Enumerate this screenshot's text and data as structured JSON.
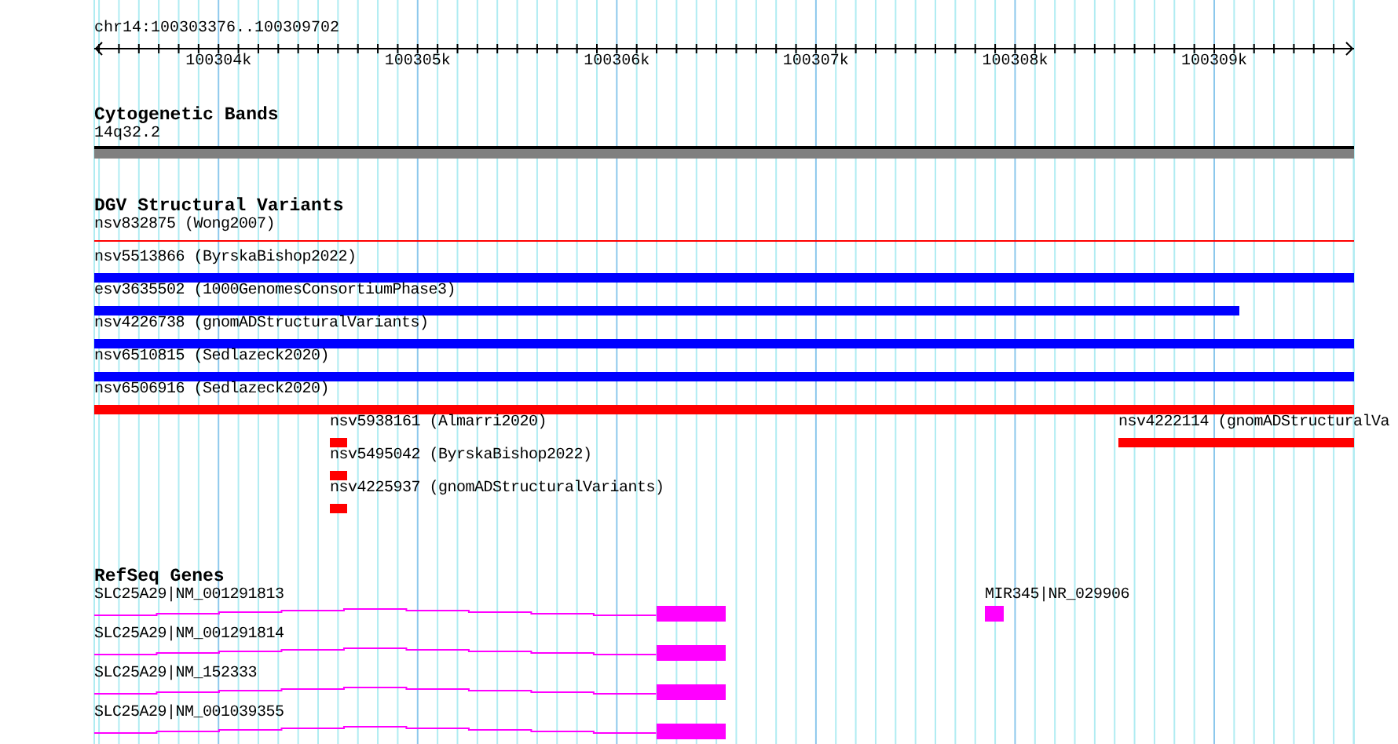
{
  "ruler": {
    "region": "chr14:100303376..100309702",
    "ticks": [
      "100304k",
      "100305k",
      "100306k",
      "100307k",
      "100308k",
      "100309k"
    ]
  },
  "tracks": [
    {
      "kind": "bands",
      "title": "Cytogenetic Bands",
      "rows": [
        {
          "features": [
            {
              "kind": "band",
              "label": "14q32.2",
              "color": "#808080"
            }
          ]
        }
      ]
    },
    {
      "kind": "variants",
      "title": "DGV Structural Variants",
      "rows": [
        {
          "features": [
            {
              "kind": "line",
              "label": "nsv832875 (Wong2007)",
              "color": "#ff0000"
            }
          ]
        },
        {
          "features": [
            {
              "kind": "bar",
              "label": "nsv5513866 (ByrskaBishop2022)",
              "color": "#0000ff"
            }
          ]
        },
        {
          "features": [
            {
              "kind": "bar",
              "label": "esv3635502 (1000GenomesConsortiumPhase3)",
              "color": "#0000ff"
            }
          ]
        },
        {
          "features": [
            {
              "kind": "bar",
              "label": "nsv4226738 (gnomADStructuralVariants)",
              "color": "#0000ff"
            }
          ]
        },
        {
          "features": [
            {
              "kind": "bar",
              "label": "nsv6510815 (Sedlazeck2020)",
              "color": "#0000ff"
            }
          ]
        },
        {
          "features": [
            {
              "kind": "bar",
              "label": "nsv6506916 (Sedlazeck2020)",
              "color": "#ff0000"
            }
          ]
        },
        {
          "features": [
            {
              "kind": "bar",
              "label": "nsv5938161 (Almarri2020)",
              "color": "#ff0000"
            },
            {
              "kind": "bar",
              "label": "nsv4222114 (gnomADStructuralVa",
              "color": "#ff0000"
            }
          ]
        },
        {
          "features": [
            {
              "kind": "bar",
              "label": "nsv5495042 (ByrskaBishop2022)",
              "color": "#ff0000"
            }
          ]
        },
        {
          "features": [
            {
              "kind": "bar",
              "label": "nsv4225937 (gnomADStructuralVariants)",
              "color": "#ff0000"
            }
          ]
        }
      ]
    },
    {
      "kind": "genes",
      "title": "RefSeq Genes",
      "rows": [
        {
          "features": [
            {
              "kind": "transcript",
              "label": "SLC25A29|NM_001291813",
              "color": "#ff00ff"
            },
            {
              "kind": "exon",
              "label": "MIR345|NR_029906",
              "color": "#ff00ff"
            }
          ]
        },
        {
          "features": [
            {
              "kind": "transcript",
              "label": "SLC25A29|NM_001291814",
              "color": "#ff00ff"
            }
          ]
        },
        {
          "features": [
            {
              "kind": "transcript",
              "label": "SLC25A29|NM_152333",
              "color": "#ff00ff"
            }
          ]
        },
        {
          "features": [
            {
              "kind": "transcript",
              "label": "SLC25A29|NM_001039355",
              "color": "#ff00ff"
            }
          ]
        }
      ]
    }
  ]
}
